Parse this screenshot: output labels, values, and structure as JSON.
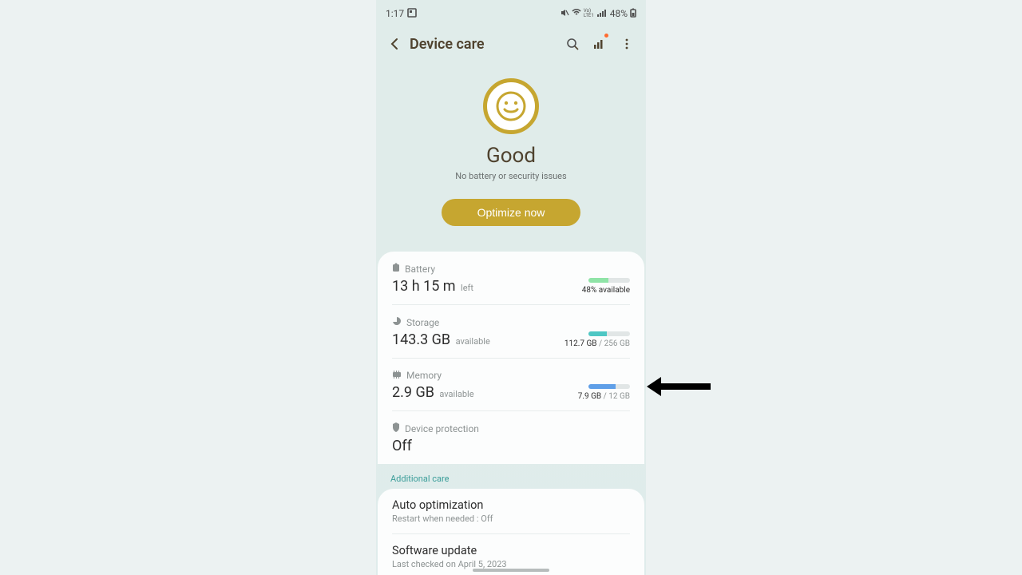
{
  "status": {
    "time": "1:17",
    "battery_pct": "48%"
  },
  "header": {
    "title": "Device care"
  },
  "hero": {
    "status": "Good",
    "subtitle": "No battery or security issues",
    "optimize_label": "Optimize now"
  },
  "battery": {
    "label": "Battery",
    "value": "13 h 15 m",
    "suffix": "left",
    "available": "48% available",
    "pct": 48
  },
  "storage": {
    "label": "Storage",
    "value": "143.3 GB",
    "suffix": "available",
    "used": "112.7 GB",
    "total": "256 GB",
    "pct": 44
  },
  "memory": {
    "label": "Memory",
    "value": "2.9 GB",
    "suffix": "available",
    "used": "7.9 GB",
    "total": "12 GB",
    "pct": 66
  },
  "protection": {
    "label": "Device protection",
    "value": "Off"
  },
  "additional": {
    "heading": "Additional care",
    "auto_opt": {
      "title": "Auto optimization",
      "sub": "Restart when needed : Off"
    },
    "software": {
      "title": "Software update",
      "sub": "Last checked on April 5, 2023"
    }
  }
}
